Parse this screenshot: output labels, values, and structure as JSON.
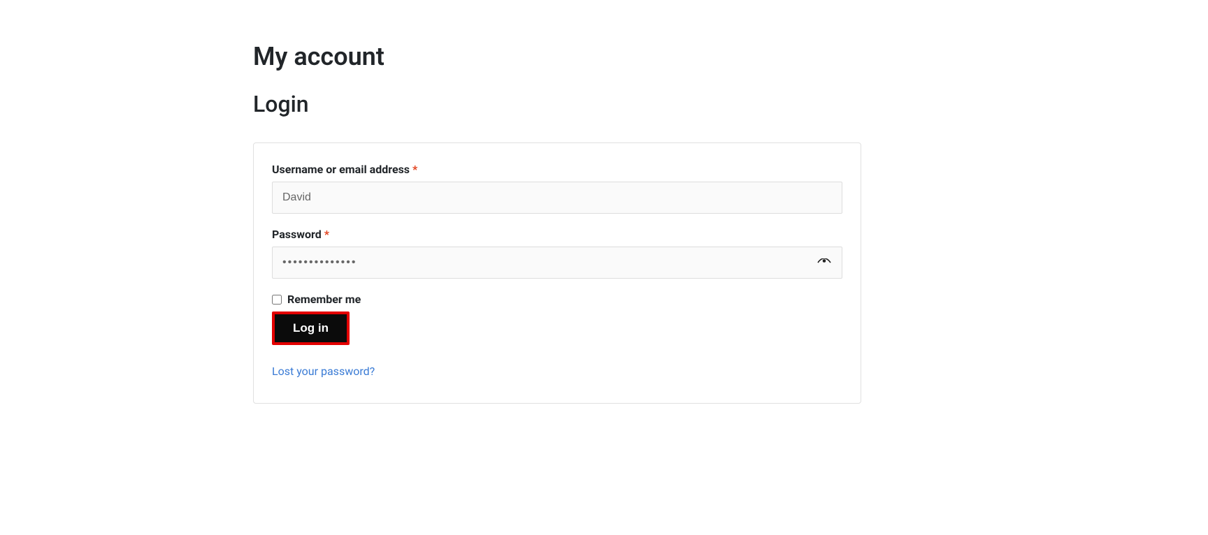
{
  "page": {
    "title": "My account",
    "section": "Login"
  },
  "form": {
    "username": {
      "label": "Username or email address",
      "required_mark": "*",
      "value": "David"
    },
    "password": {
      "label": "Password",
      "required_mark": "*",
      "value": "••••••••••••••"
    },
    "remember": {
      "label": "Remember me",
      "checked": false
    },
    "submit_label": "Log in",
    "lost_password_label": "Lost your password?"
  }
}
